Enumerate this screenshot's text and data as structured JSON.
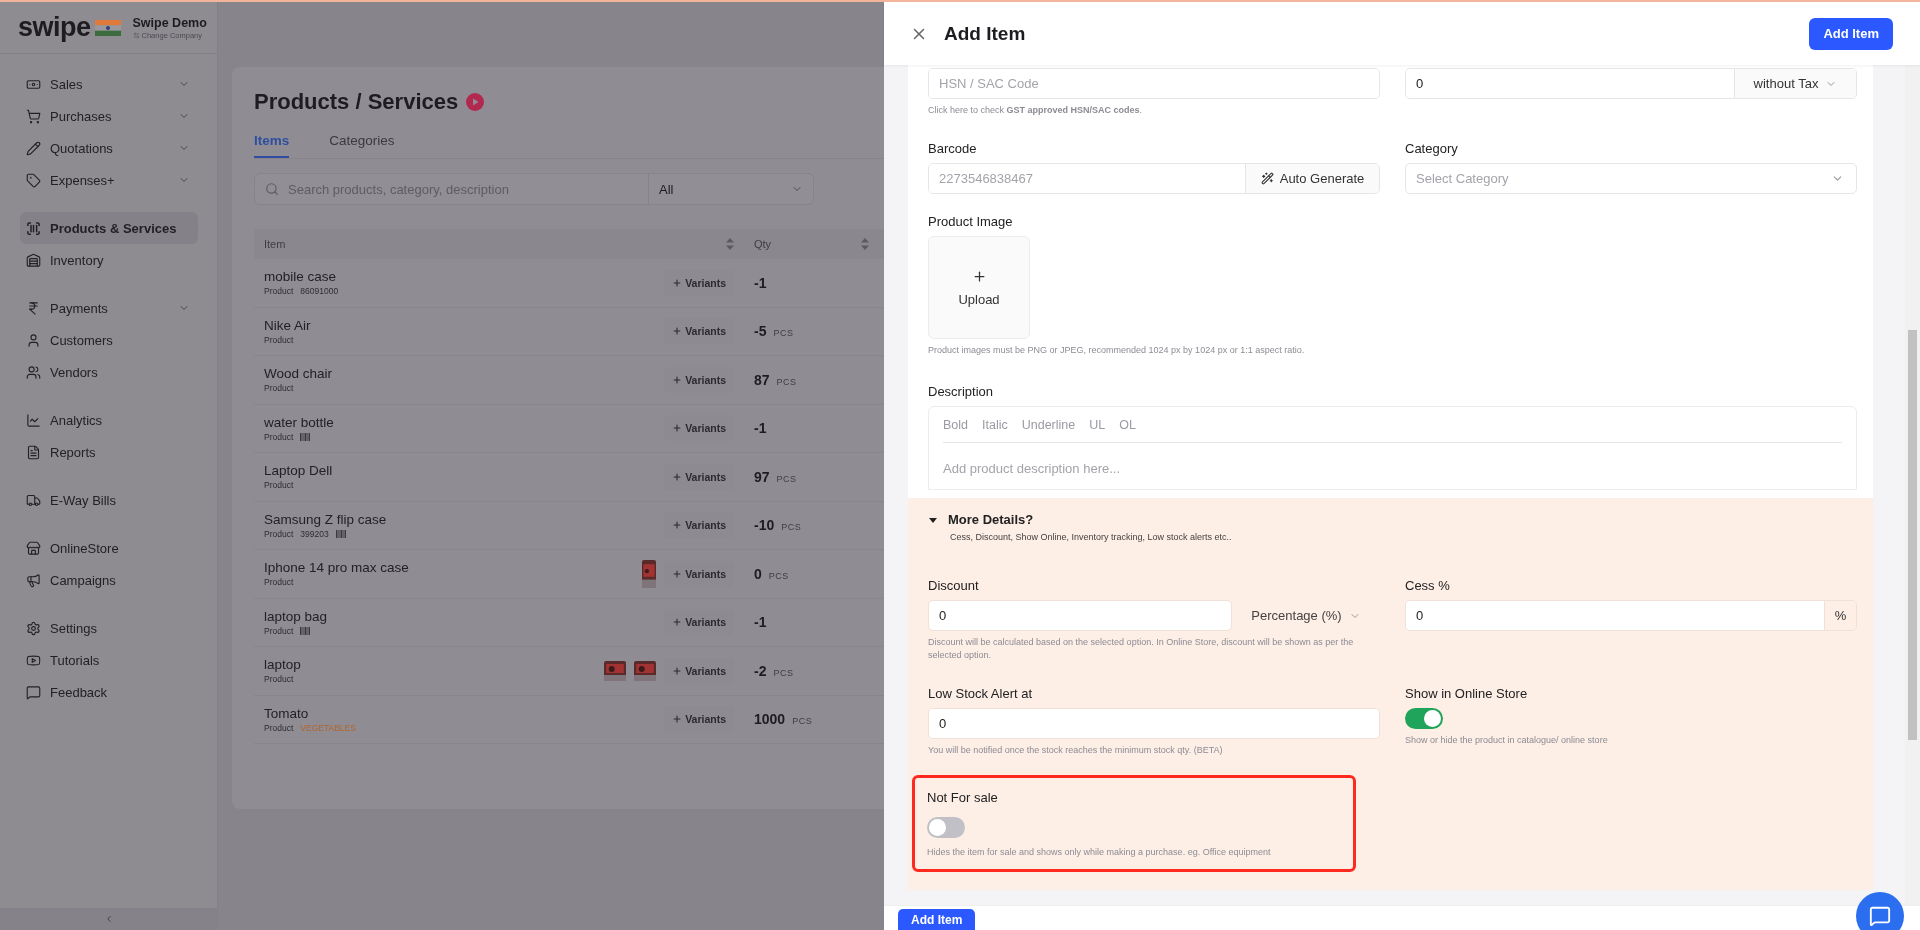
{
  "app": {
    "brand": "swipe",
    "company": "Swipe Demo",
    "company_hint": "Change Company"
  },
  "sidebar": {
    "groups": [
      {
        "items": [
          {
            "label": "Sales",
            "has_submenu": true,
            "selected": false
          },
          {
            "label": "Purchases",
            "has_submenu": true,
            "selected": false
          },
          {
            "label": "Quotations",
            "has_submenu": true,
            "selected": false
          },
          {
            "label": "Expenses+",
            "has_submenu": true,
            "selected": false
          }
        ]
      },
      {
        "items": [
          {
            "label": "Products & Services",
            "has_submenu": false,
            "selected": true
          },
          {
            "label": "Inventory",
            "has_submenu": false,
            "selected": false
          }
        ]
      },
      {
        "items": [
          {
            "label": "Payments",
            "has_submenu": true,
            "selected": false
          },
          {
            "label": "Customers",
            "has_submenu": false,
            "selected": false
          },
          {
            "label": "Vendors",
            "has_submenu": false,
            "selected": false
          }
        ]
      },
      {
        "items": [
          {
            "label": "Analytics",
            "has_submenu": false,
            "selected": false
          },
          {
            "label": "Reports",
            "has_submenu": false,
            "selected": false
          }
        ]
      },
      {
        "items": [
          {
            "label": "E-Way Bills",
            "has_submenu": false,
            "selected": false
          }
        ]
      },
      {
        "items": [
          {
            "label": "OnlineStore",
            "has_submenu": false,
            "selected": false
          },
          {
            "label": "Campaigns",
            "has_submenu": false,
            "selected": false
          }
        ]
      },
      {
        "items": [
          {
            "label": "Settings",
            "has_submenu": false,
            "selected": false
          },
          {
            "label": "Tutorials",
            "has_submenu": false,
            "selected": false
          },
          {
            "label": "Feedback",
            "has_submenu": false,
            "selected": false
          }
        ]
      }
    ]
  },
  "page": {
    "title": "Products / Services",
    "tabs": [
      {
        "label": "Items",
        "selected": true
      },
      {
        "label": "Categories",
        "selected": false
      }
    ],
    "search": {
      "placeholder": "Search products, category, description"
    },
    "filter": {
      "value": "All"
    },
    "table": {
      "columns": [
        "Item",
        "Qty"
      ],
      "rows": [
        {
          "name": "mobile case",
          "type": "Product",
          "code": "86091000",
          "has_barcode": false,
          "variants": "Variants",
          "qty": "-1"
        },
        {
          "name": "Nike Air",
          "type": "Product",
          "has_barcode": false,
          "variants": "Variants",
          "qty": "-5",
          "unit": "PCS"
        },
        {
          "name": "Wood chair",
          "type": "Product",
          "has_barcode": false,
          "variants": "Variants",
          "qty": "87",
          "unit": "PCS"
        },
        {
          "name": "water bottle",
          "type": "Product",
          "has_barcode": true,
          "variants": "Variants",
          "qty": "-1"
        },
        {
          "name": "Laptop Dell",
          "type": "Product",
          "has_barcode": false,
          "variants": "Variants",
          "qty": "97",
          "unit": "PCS"
        },
        {
          "name": "Samsung Z flip case",
          "type": "Product",
          "code": "399203",
          "has_barcode": true,
          "variants": "Variants",
          "qty": "-10",
          "unit": "PCS"
        },
        {
          "name": "Iphone 14 pro max case",
          "type": "Product",
          "has_barcode": false,
          "variants": "Variants",
          "qty": "0",
          "unit": "PCS"
        },
        {
          "name": "laptop bag",
          "type": "Product",
          "has_barcode": true,
          "variants": "Variants",
          "qty": "-1"
        },
        {
          "name": "laptop",
          "type": "Product",
          "has_barcode": false,
          "variants": "Variants",
          "qty": "-2",
          "unit": "PCS"
        },
        {
          "name": "Tomato",
          "type": "Product",
          "category": "VEGETABLES",
          "has_barcode": false,
          "variants": "Variants",
          "qty": "1000",
          "unit": "PCS"
        }
      ]
    }
  },
  "drawer": {
    "title": "Add Item",
    "primary_button": "Add Item",
    "hsn": {
      "placeholder": "HSN / SAC Code",
      "hint": "Click here to check **GST approved HSN/SAC codes**."
    },
    "price": {
      "value": "0",
      "tax_mode": "without Tax"
    },
    "barcode": {
      "label": "Barcode",
      "placeholder": "2273546838467",
      "button": "Auto Generate"
    },
    "category": {
      "label": "Category",
      "placeholder": "Select Category"
    },
    "image": {
      "label": "Product Image",
      "button": "Upload",
      "hint": "Product images must be PNG or JPEG, recommended 1024 px by 1024 px or 1:1 aspect ratio."
    },
    "description": {
      "label": "Description",
      "toolbar": [
        "Bold",
        "Italic",
        "Underline",
        "UL",
        "OL"
      ],
      "placeholder": "Add product description here..."
    },
    "more_details": {
      "title": "More Details?",
      "subtitle": "Cess, Discount, Show Online, Inventory tracking, Low stock alerts etc..",
      "expanded": true,
      "discount": {
        "label": "Discount",
        "value": "0",
        "unit": "Percentage (%)",
        "hint": "Discount will be calculated based on the selected option. In Online Store, discount will be shown as per the selected option."
      },
      "cess": {
        "label": "Cess %",
        "value": "0",
        "unit": "%"
      },
      "low_stock": {
        "label": "Low Stock Alert at",
        "value": "0",
        "hint": "You will be notified once the stock reaches the minimum stock qty. (BETA)"
      },
      "online_store": {
        "label": "Show in Online Store",
        "on": true,
        "hint": "Show or hide the product in catalogue/ online store"
      },
      "not_for_sale": {
        "label": "Not For sale",
        "on": false,
        "highlighted": true,
        "hint": "Hides the item for sale and shows only while making a purchase. eg. Office equipment"
      }
    },
    "footer_button": "Add Item"
  }
}
